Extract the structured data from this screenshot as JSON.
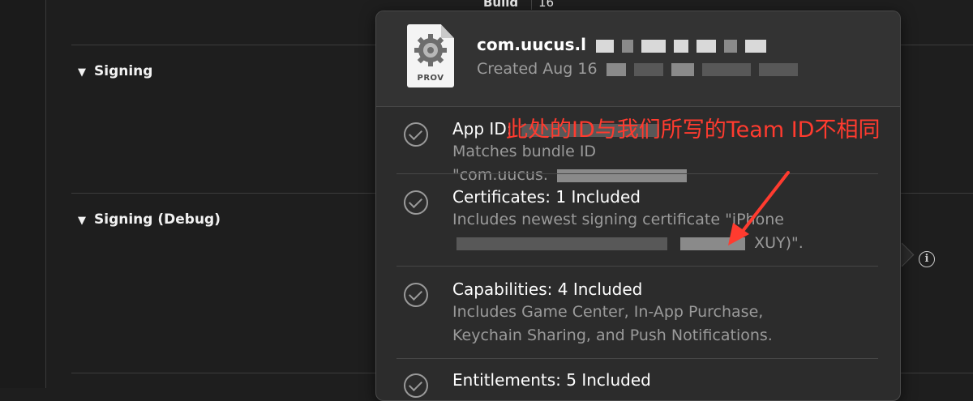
{
  "settings": {
    "build_label": "Build",
    "build_value": "16",
    "sections": [
      {
        "label": "Signing"
      },
      {
        "label": "Signing (Debug)"
      }
    ]
  },
  "popover": {
    "icon_label": "PROV",
    "profile_name": "com.uucus.l",
    "created_prefix": "Created",
    "created_date": "Aug 16",
    "items": [
      {
        "title": "App ID:",
        "desc1": "Matches bundle ID",
        "desc2": "\"com.uucus."
      },
      {
        "title": "Certificates: 1 Included",
        "desc1": "Includes newest signing certificate \"iPhone",
        "desc2": "XUY)\"."
      },
      {
        "title": "Capabilities: 4 Included",
        "desc1": "Includes Game Center, In-App Purchase,",
        "desc2": "Keychain Sharing, and Push Notifications."
      },
      {
        "title": "Entitlements: 5 Included"
      }
    ]
  },
  "annotation": {
    "text": "此处的ID与我们所写的Team ID不相同",
    "color": "#ff3b2f"
  },
  "colors": {
    "background": "#1e1e1e",
    "popover": "#2c2c2c",
    "accent_annotation": "#ff3b2f"
  }
}
